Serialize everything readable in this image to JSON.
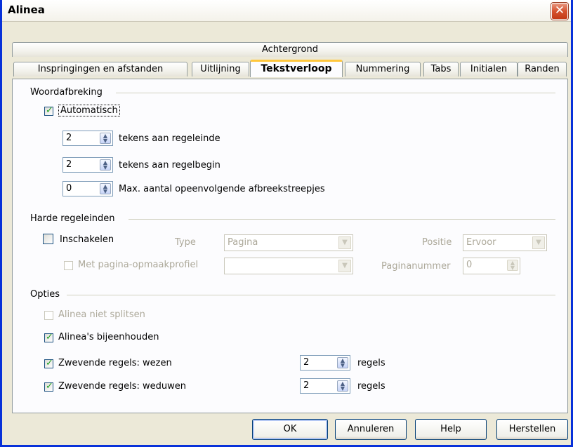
{
  "window": {
    "title": "Alinea",
    "close_glyph": "✕"
  },
  "tabs": {
    "row1": [
      {
        "label": "Achtergrond"
      }
    ],
    "row2": [
      {
        "label": "Inspringingen en afstanden"
      },
      {
        "label": "Uitlijning"
      },
      {
        "label": "Tekstverloop",
        "active": true
      },
      {
        "label": "Nummering"
      },
      {
        "label": "Tabs"
      },
      {
        "label": "Initialen"
      },
      {
        "label": "Randen"
      }
    ]
  },
  "hyphenation": {
    "section_label": "Woordafbreking",
    "automatic": {
      "label": "Automatisch",
      "checked": true
    },
    "line_end": {
      "value": "2",
      "label": "tekens aan regeleinde"
    },
    "line_begin": {
      "value": "2",
      "label": "tekens aan regelbegin"
    },
    "max_hyphens": {
      "value": "0",
      "label": "Max. aantal opeenvolgende afbreekstreepjes"
    }
  },
  "breaks": {
    "section_label": "Harde regeleinden",
    "enable": {
      "label": "Inschakelen",
      "checked": false
    },
    "type_label": "Type",
    "type_value": "Pagina",
    "position_label": "Positie",
    "position_value": "Ervoor",
    "with_page_style": {
      "label": "Met pagina-opmaakprofiel",
      "checked": false
    },
    "page_style_value": "",
    "page_number_label": "Paginanummer",
    "page_number_value": "0"
  },
  "options": {
    "section_label": "Opties",
    "do_not_split": {
      "label": "Alinea niet splitsen",
      "checked": false
    },
    "keep_together": {
      "label": "Alinea's bijeenhouden",
      "checked": true
    },
    "orphan": {
      "label": "Zwevende regels: wezen",
      "checked": true,
      "value": "2",
      "unit": "regels"
    },
    "widow": {
      "label": "Zwevende regels: weduwen",
      "checked": true,
      "value": "2",
      "unit": "regels"
    }
  },
  "buttons": {
    "ok": "OK",
    "cancel": "Annuleren",
    "help": "Help",
    "reset": "Herstellen"
  },
  "colors": {
    "active_tab_accent": "#ffc73c",
    "title_border": "#0831d9",
    "check": "#21a121"
  }
}
